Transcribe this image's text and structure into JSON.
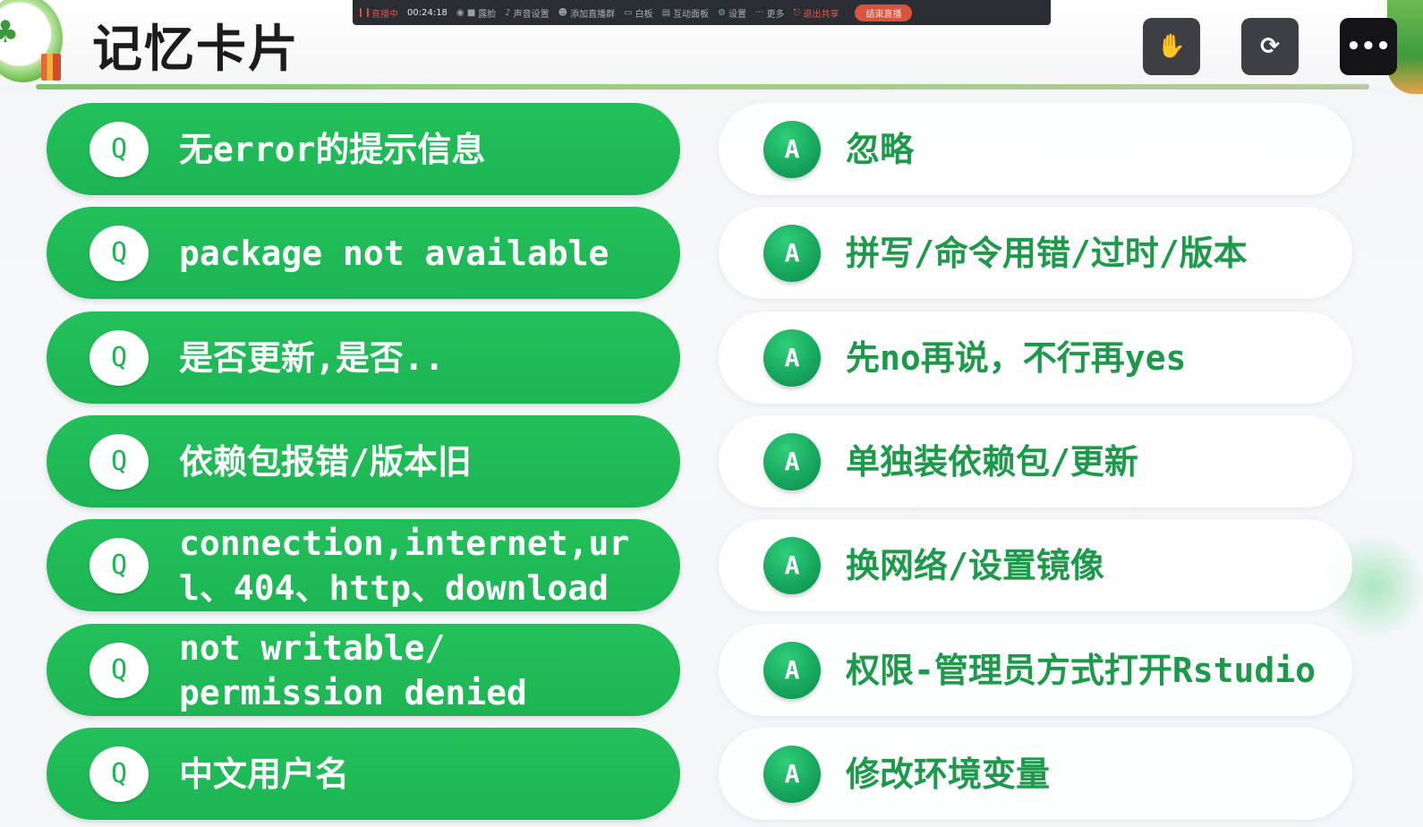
{
  "header": {
    "title": "记忆卡片"
  },
  "toolbar": {
    "live_label": "直播中",
    "time": "00:24:18",
    "items": [
      "露脸",
      "声音设置",
      "添加直播群",
      "白板",
      "互动面板",
      "设置",
      "更多"
    ],
    "exit_share": "退出共享",
    "end_live": "结束直播"
  },
  "cards": [
    {
      "q_badge": "Q",
      "q": "无error的提示信息",
      "a_badge": "A",
      "a": "忽略"
    },
    {
      "q_badge": "Q",
      "q": "package not available",
      "a_badge": "A",
      "a": "拼写/命令用错/过时/版本"
    },
    {
      "q_badge": "Q",
      "q": "是否更新,是否..",
      "a_badge": "A",
      "a": "先no再说，不行再yes"
    },
    {
      "q_badge": "Q",
      "q": "依赖包报错/版本旧",
      "a_badge": "A",
      "a": "单独装依赖包/更新"
    },
    {
      "q_badge": "Q",
      "q": "connection,internet,ur\nl、404、http、download",
      "a_badge": "A",
      "a": "换网络/设置镜像"
    },
    {
      "q_badge": "Q",
      "q": "not writable/\npermission denied",
      "a_badge": "A",
      "a": "权限-管理员方式打开Rstudio"
    },
    {
      "q_badge": "Q",
      "q": "中文用户名",
      "a_badge": "A",
      "a": "修改环境变量"
    }
  ],
  "colors": {
    "q_card": "#1db554",
    "a_text": "#1c9a4a",
    "title": "#1c1c1c"
  }
}
